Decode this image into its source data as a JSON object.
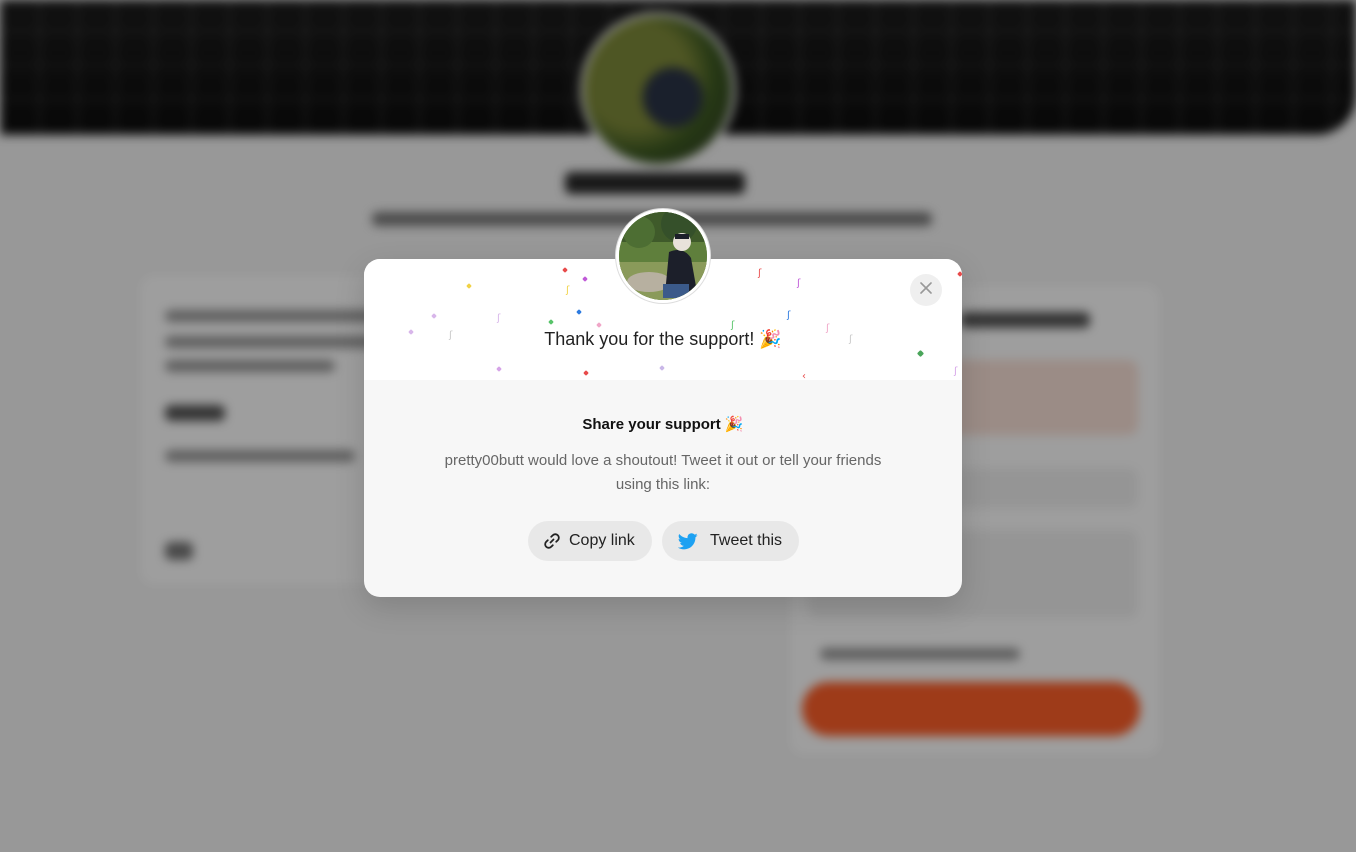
{
  "modal": {
    "thanks_text": "Thank you for the support! 🎉",
    "share_title": "Share your support 🎉",
    "share_description": "pretty00butt would love a shoutout! Tweet it out or tell your friends using this link:",
    "copy_link_label": "Copy link",
    "tweet_label": "Tweet this",
    "close_icon": "close-icon",
    "accent_twitter": "#1DA1F2",
    "cta_color": "#FF5F29"
  }
}
